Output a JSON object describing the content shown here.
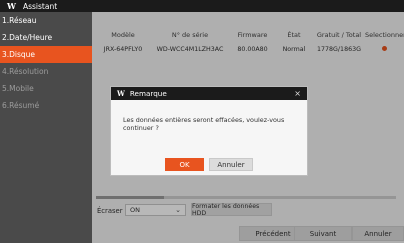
{
  "window": {
    "logo": "W",
    "title": "Assistant"
  },
  "sidebar": {
    "items": [
      {
        "label": "1.Réseau",
        "state": "done"
      },
      {
        "label": "2.Date/Heure",
        "state": "done"
      },
      {
        "label": "3.Disque",
        "state": "active"
      },
      {
        "label": "4.Résolution",
        "state": "pending"
      },
      {
        "label": "5.Mobile",
        "state": "pending"
      },
      {
        "label": "6.Résumé",
        "state": "pending"
      }
    ]
  },
  "table": {
    "headers": [
      "Modèle",
      "N° de série",
      "Firmware",
      "État",
      "Gratuit / Total",
      "Selectionner"
    ],
    "rows": [
      {
        "model": "JRX-64PFLY0",
        "serial": "WD-WCC4M1LZH3AC",
        "firmware": "80.00A80",
        "state": "Normal",
        "free_total": "1778G/1863G",
        "selected": true
      }
    ]
  },
  "erase": {
    "label": "Écraser",
    "value": "ON"
  },
  "format_button": "Formater les données HDD",
  "footer": {
    "prev": "Précédent",
    "next": "Suivant",
    "cancel": "Annuler"
  },
  "dialog": {
    "logo": "W",
    "title": "Remarque",
    "close": "×",
    "message": "Les données entières seront effacées, voulez-vous continuer ?",
    "ok": "OK",
    "cancel": "Annuler"
  },
  "colors": {
    "accent": "#e8541f",
    "sidebar": "#4a4a4a",
    "titlebar": "#1b1b1b"
  }
}
